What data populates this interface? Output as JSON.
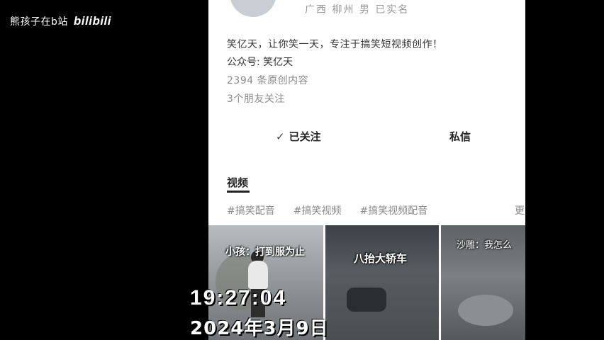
{
  "watermark": {
    "text": "熊孩子在b站",
    "logo": "bilibili"
  },
  "profile": {
    "location_line": "广西 柳州 男 已实名",
    "bio": "笑亿天，让你笑一天，专注于搞笑短视频创作！",
    "official_account": "公众号: 笑亿天",
    "works_count": "2394 条原创内容",
    "friends_following": "3个朋友关注"
  },
  "actions": {
    "follow_label": "已关注",
    "follow_icon": "check-icon",
    "message_label": "私信"
  },
  "tabs": {
    "video_label": "视频"
  },
  "tags": [
    "#搞笑配音",
    "#搞笑视频",
    "#搞笑视频配音"
  ],
  "tag_more": "更",
  "thumbnails": [
    {
      "caption": "小孩：打到服为止"
    },
    {
      "caption": "八抬大轿车"
    },
    {
      "caption": "沙雕：我怎么"
    }
  ],
  "timestamp": {
    "time": "19:27:04",
    "date": "2024年3月9日"
  }
}
